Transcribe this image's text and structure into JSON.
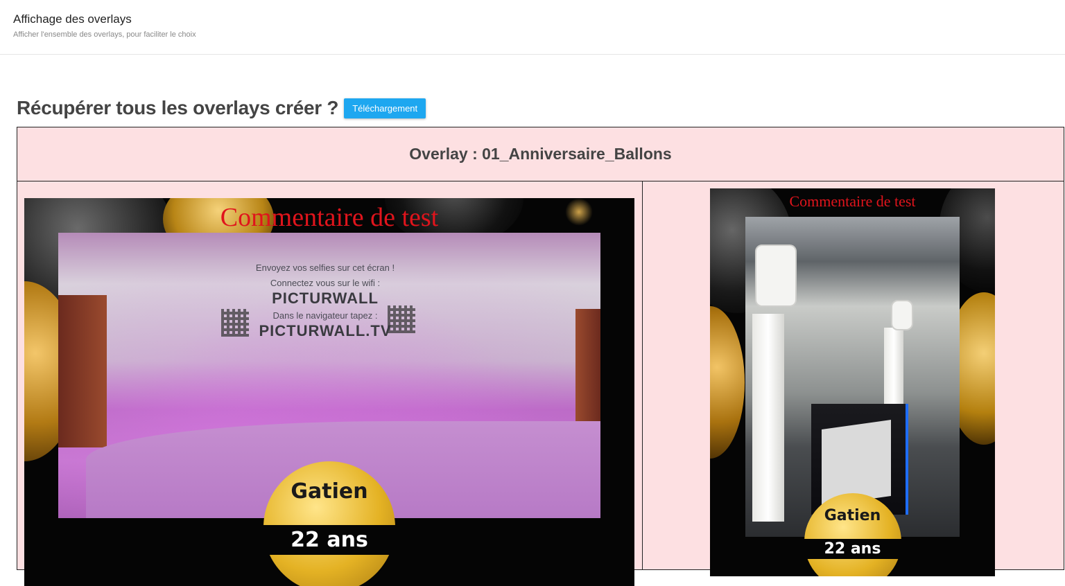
{
  "header": {
    "title": "Affichage des overlays",
    "subtitle": "Afficher l'ensemble des overlays, pour faciliter le choix"
  },
  "main": {
    "heading": "Récupérer tous les overlays créer ?",
    "download_label": "Téléchargement",
    "overlay_title": "Overlay : 01_Anniversaire_Ballons",
    "previews": [
      {
        "orientation": "landscape",
        "comment": "Commentaire de test",
        "wall_lines": [
          "Envoyez vos selfies sur cet écran !",
          "Connectez vous sur le wifi :",
          "PICTURWALL",
          "Dans le navigateur tapez :",
          "PICTURWALL.TV"
        ],
        "badge_name": "Gatien",
        "badge_age": "22 ans"
      },
      {
        "orientation": "portrait",
        "comment": "Commentaire de test",
        "badge_name": "Gatien",
        "badge_age": "22 ans"
      }
    ]
  },
  "colors": {
    "accent": "#1ea7f0",
    "table_bg": "#fde0e2",
    "comment_red": "#e0141c",
    "gold": "#e4b224"
  }
}
